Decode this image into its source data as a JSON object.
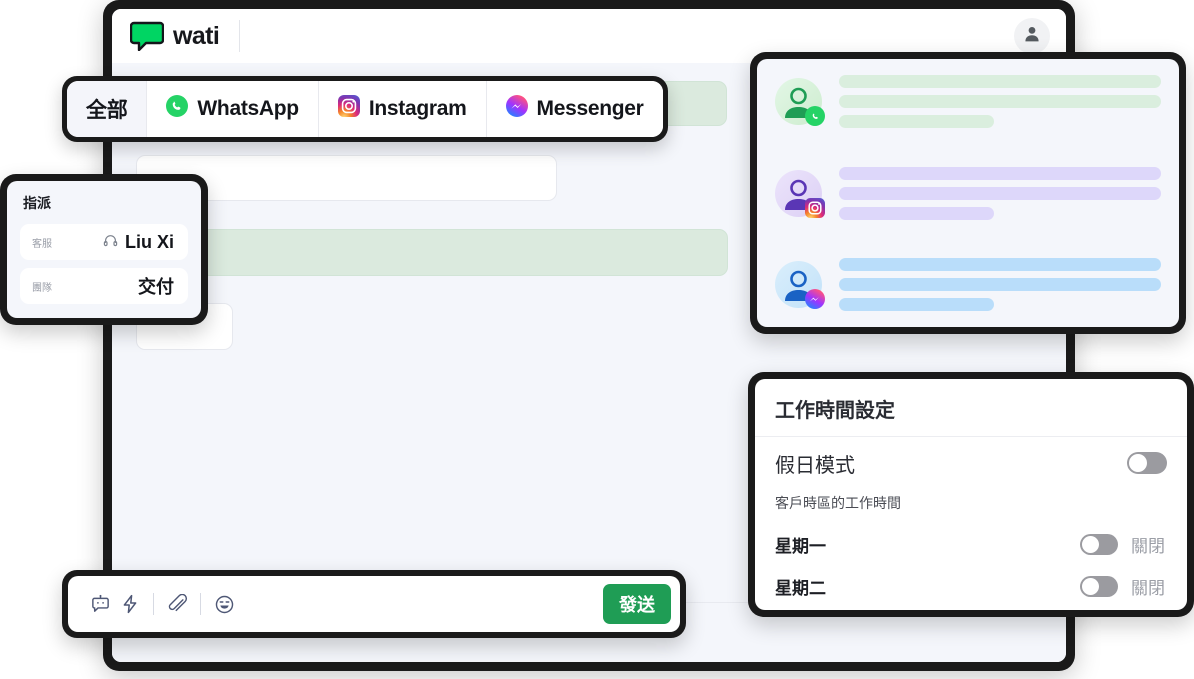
{
  "brand": {
    "name": "wati",
    "logo_icon": "chat-bubble-logo",
    "accent_green": "#00d563"
  },
  "header": {
    "avatar_icon": "user-avatar-icon"
  },
  "channel_tabs": [
    {
      "label": "全部",
      "icon": "none",
      "active": true
    },
    {
      "label": "WhatsApp",
      "icon": "whatsapp-icon",
      "active": false
    },
    {
      "label": "Instagram",
      "icon": "instagram-icon",
      "active": false
    },
    {
      "label": "Messenger",
      "icon": "messenger-icon",
      "active": false
    }
  ],
  "assign_panel": {
    "title": "指派",
    "fields": [
      {
        "label": "客服",
        "value": "Liu Xi",
        "icon": "headset-icon"
      },
      {
        "label": "團隊",
        "value": "交付",
        "icon": "none"
      }
    ]
  },
  "chat_list": {
    "rows": [
      {
        "channel": "whatsapp",
        "badge_icon": "whatsapp-icon",
        "avatar_icon": "person-avatar-icon"
      },
      {
        "channel": "instagram",
        "badge_icon": "instagram-icon",
        "avatar_icon": "person-avatar-icon"
      },
      {
        "channel": "messenger",
        "badge_icon": "messenger-icon",
        "avatar_icon": "person-avatar-icon"
      }
    ]
  },
  "working_hours": {
    "title": "工作時間設定",
    "holiday_mode": {
      "label": "假日模式",
      "enabled": false
    },
    "note": "客戶時區的工作時間",
    "days": [
      {
        "name": "星期一",
        "state": "關閉",
        "enabled": false
      },
      {
        "name": "星期二",
        "state": "關閉",
        "enabled": false
      }
    ]
  },
  "composer": {
    "tools": [
      {
        "icon": "bot-icon",
        "name": "chatbot"
      },
      {
        "icon": "lightning-icon",
        "name": "quick-reply"
      },
      {
        "icon": "paperclip-icon",
        "name": "attachment"
      },
      {
        "icon": "smiley-icon",
        "name": "emoji"
      }
    ],
    "send_label": "發送",
    "send_color": "#1f9d55"
  },
  "messages": [
    {
      "type": "outgoing",
      "color": "#dbeade"
    },
    {
      "type": "incoming",
      "color": "#ffffff"
    },
    {
      "type": "outgoing",
      "color": "#dbeade"
    },
    {
      "type": "incoming",
      "color": "#ffffff"
    }
  ]
}
